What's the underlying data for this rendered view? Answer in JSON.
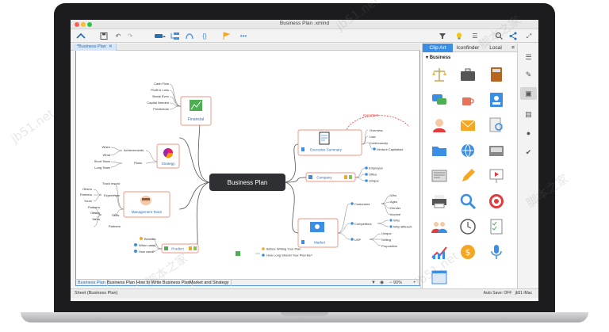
{
  "window": {
    "title": "Business Plan .xmind"
  },
  "toolbar": {
    "items": [
      "home-icon",
      "save-icon",
      "undo-icon",
      "redo-icon",
      "topic-icon",
      "subtopic-icon",
      "relationship-icon",
      "boundary-icon",
      "marker-icon",
      "more-icon",
      "filter-icon",
      "idea-icon",
      "outline-icon",
      "search-icon",
      "share-icon",
      "fullscreen-icon"
    ]
  },
  "document_tab": {
    "label": "*Business Plan"
  },
  "mindmap": {
    "central": "Business Plan",
    "branches": {
      "financial": {
        "label": "Financial",
        "children": [
          "Cash Flow",
          "Profit & Loss",
          "Break Even",
          "Capital Needed",
          "Predictions"
        ]
      },
      "strategy": {
        "label": "Strategy",
        "children": [
          "When",
          "What",
          "Short Team",
          "Long Team"
        ],
        "sub": [
          "Achievements",
          "Plans"
        ]
      },
      "management": {
        "label": "Management Team",
        "children": [
          "Others",
          "Partners",
          "Yours",
          "Partners",
          "Others",
          "Yours",
          "Partners"
        ],
        "sub": [
          "Track record",
          "Experience",
          "Skills"
        ]
      },
      "product": {
        "label": "Product",
        "children": [
          "Benefits",
          "When used?",
          "How used?"
        ]
      },
      "executive": {
        "label": "Executive Summary",
        "children": [
          "Overview",
          "Last",
          "Continuously",
          "Venture Capitalists"
        ],
        "callout": "Important"
      },
      "company": {
        "label": "Company",
        "children": [
          "Employee",
          "Office",
          "Unique"
        ]
      },
      "market": {
        "label": "Market",
        "children": [
          "Customers",
          "Competitors",
          "USP"
        ],
        "leaves": [
          "Who",
          "Ages",
          "Gender",
          "Income",
          "Who",
          "Why different",
          "Unique",
          "Selling",
          "Proposition"
        ]
      },
      "floating": [
        "Before Writing Your Plan",
        "How Long Should Your Plan Be?"
      ]
    }
  },
  "sheet_tabs": [
    "Business Plan",
    "Business Plan",
    "How to Write Business Plan",
    "Market and Strategy"
  ],
  "zoom": "90%",
  "status": {
    "left": "Sheet (Business Plan)",
    "autosave": "Auto Save: OFF",
    "user": "jb51 iMac"
  },
  "panel": {
    "tabs": [
      "Clip Art",
      "Iconfinder",
      "Local"
    ],
    "section": "Business",
    "clipart": [
      "scales",
      "briefcase",
      "calculator",
      "chat",
      "coffee",
      "contact-card",
      "support-agent",
      "envelope",
      "document-search",
      "folder",
      "globe",
      "inbox",
      "newspaper",
      "pencil",
      "presentation",
      "printer",
      "magnifier",
      "target",
      "team",
      "clock",
      "checklist",
      "growth-chart",
      "coin",
      "microphone",
      "window"
    ]
  },
  "strip_icons": [
    "outline-icon",
    "format-icon",
    "image-icon",
    "notes-icon",
    "comment-icon",
    "task-icon"
  ],
  "watermarks": [
    "jb51.net",
    "脚本之家"
  ],
  "colors": {
    "accent": "#3a8ee6",
    "central": "#2f3033",
    "topic_border": "#e8735a",
    "link": "#555555"
  }
}
